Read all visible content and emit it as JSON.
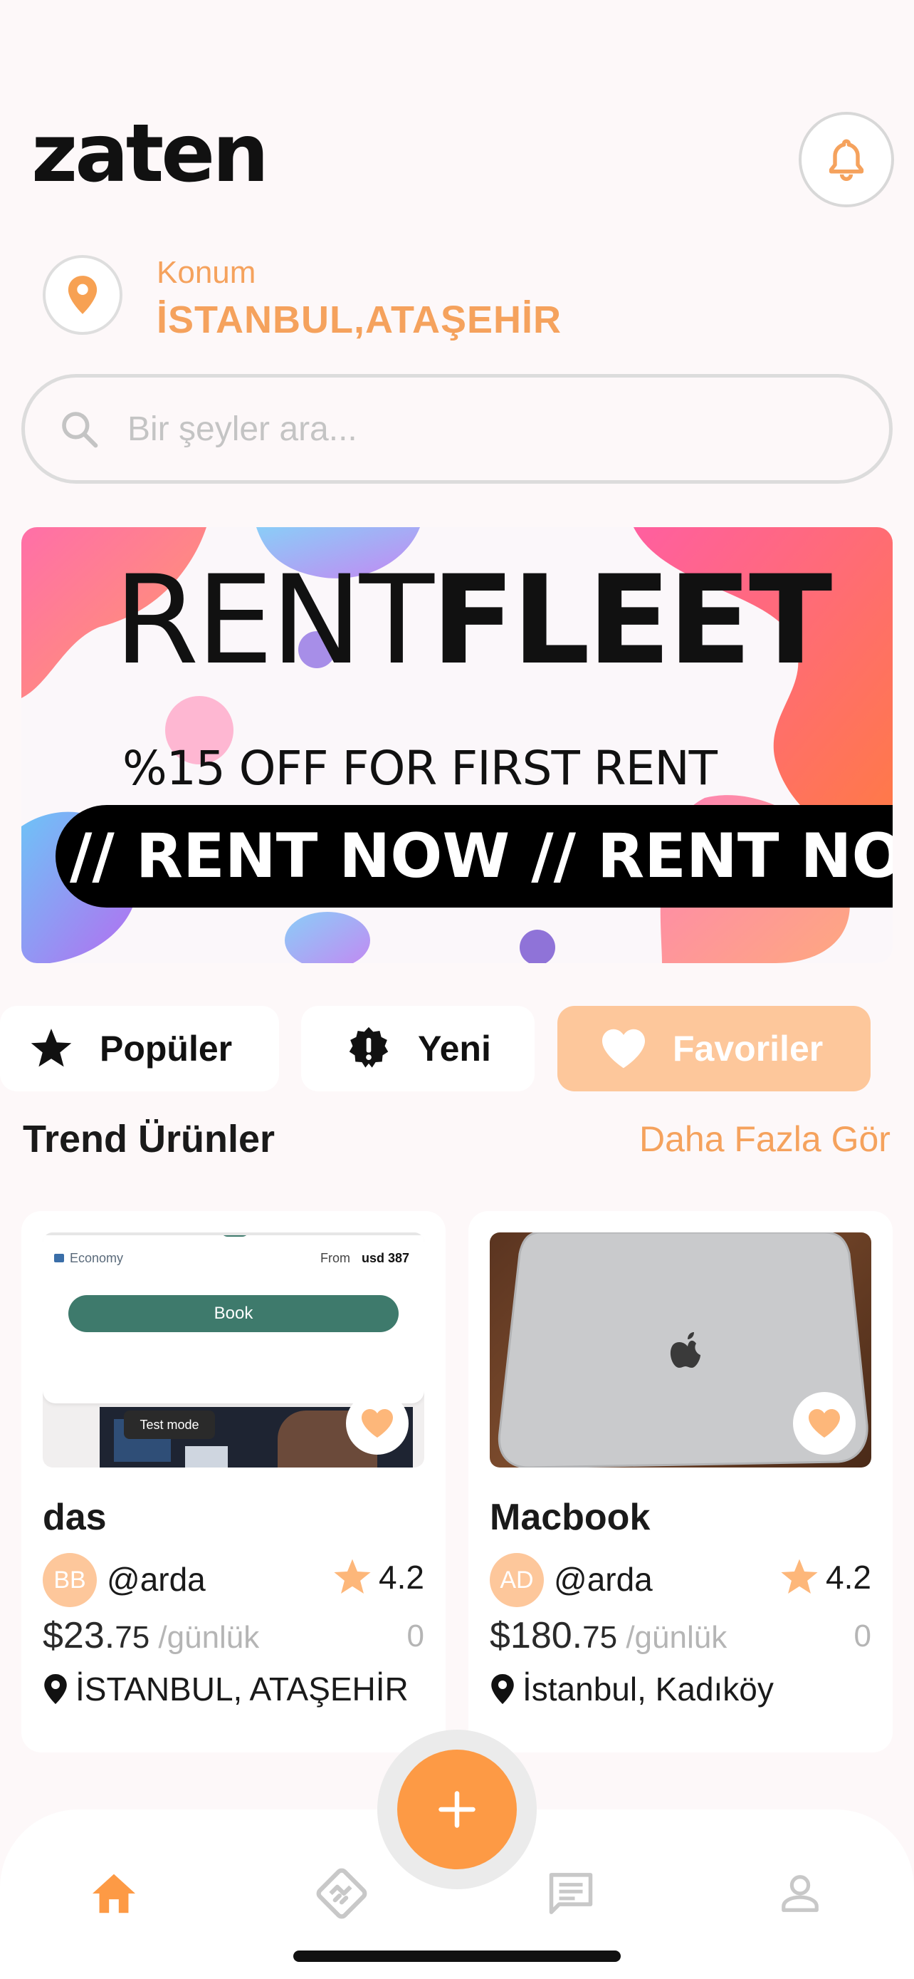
{
  "app": {
    "logo_text": "zaten"
  },
  "header": {
    "notification_icon": "bell-icon"
  },
  "location": {
    "label": "Konum",
    "value": "İSTANBUL,ATAŞEHİR",
    "icon": "map-pin-icon"
  },
  "search": {
    "placeholder": "Bir şeyler ara...",
    "icon": "search-icon"
  },
  "banner": {
    "title_light": "RENT",
    "title_bold": "FLEET",
    "subtitle": "%15 OFF FOR FIRST RENT",
    "strip_text": "// RENT NOW // RENT NOW //"
  },
  "filters": [
    {
      "label": "Popüler",
      "icon": "star-icon",
      "active": false
    },
    {
      "label": "Yeni",
      "icon": "new-badge-icon",
      "active": false
    },
    {
      "label": "Favoriler",
      "icon": "heart-icon",
      "active": true
    }
  ],
  "trend": {
    "title": "Trend Ürünler",
    "see_more": "Daha Fazla Gör"
  },
  "products": [
    {
      "title": "das",
      "avatar_initials": "BB",
      "username": "@arda",
      "rating": "4.2",
      "price_main": "$23.",
      "price_cents": "75",
      "price_unit": " /günlük",
      "count": "0",
      "location": "İSTANBUL, ATAŞEHİR",
      "image_texts": {
        "economy": "Economy",
        "from": "From",
        "price": "usd 387",
        "book": "Book",
        "test_mode": "Test mode"
      }
    },
    {
      "title": "Macbook",
      "avatar_initials": "AD",
      "username": "@arda",
      "rating": "4.2",
      "price_main": "$180.",
      "price_cents": "75",
      "price_unit": " /günlük",
      "count": "0",
      "location": "İstanbul, Kadıköy"
    }
  ],
  "nav": {
    "items": [
      "home-icon",
      "handshake-icon",
      "chat-icon",
      "profile-icon"
    ],
    "fab_icon": "plus-icon"
  },
  "colors": {
    "accent": "#f5a25d",
    "fab": "#fd9a45",
    "active_tab": "#fdc79b"
  }
}
